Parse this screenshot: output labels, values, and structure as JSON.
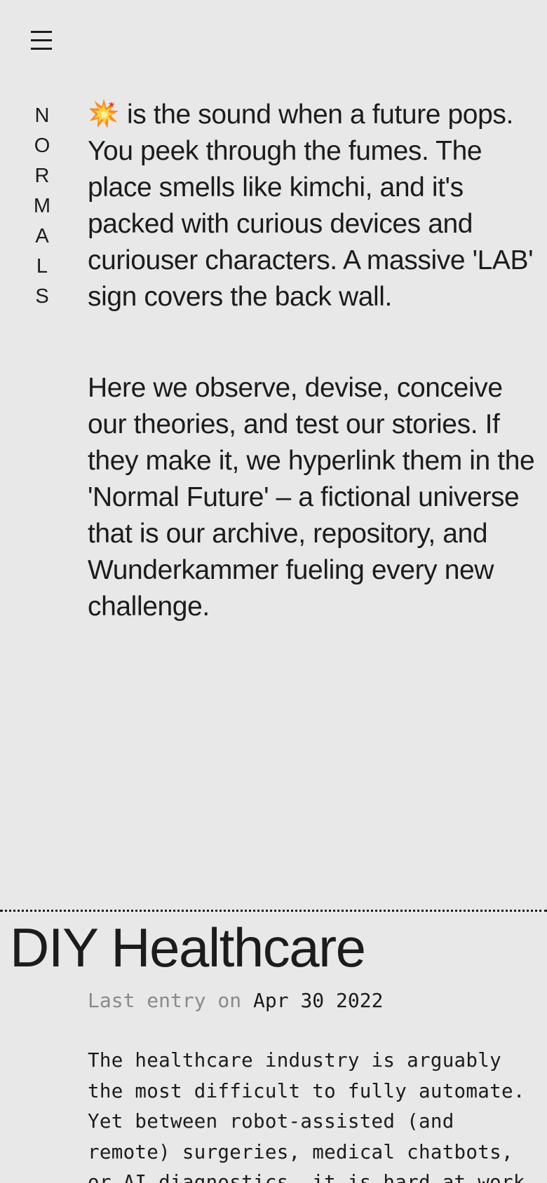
{
  "brand": {
    "letters": [
      "N",
      "O",
      "R",
      "M",
      "A",
      "L",
      "S"
    ]
  },
  "menu": {
    "icon": "hamburger-menu-icon"
  },
  "intro": {
    "emoji_icon": "collision-emoji-icon",
    "paragraph_1": "is the sound when a future pops. You peek through the fumes. The place smells like kimchi, and it's packed with curious devices and curiouser characters. A massive 'LAB' sign covers the back wall.",
    "paragraph_2": "Here we observe, devise, conceive our theories, and test our stories. If they make it, we hyperlink them in the 'Normal Future' – a fictional universe that is our archive, repository, and Wunderkammer fueling every new challenge."
  },
  "section": {
    "title": "DIY Healthcare",
    "meta_label": "Last entry on",
    "meta_date": "Apr 30 2022",
    "description": "The healthcare industry is arguably the most difficult to fully automate. Yet between robot-assisted (and remote) surgeries, medical chatbots, or AI diagnostics, it is hard at work"
  },
  "colors": {
    "background": "#e8e8e8",
    "text": "#1c1c1c",
    "muted": "#8a8a8a"
  }
}
